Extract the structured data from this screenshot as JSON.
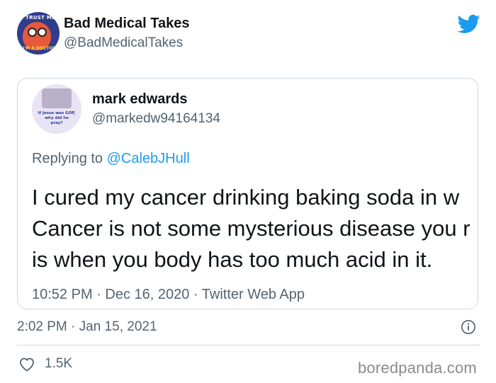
{
  "author": {
    "name": "Bad Medical Takes",
    "handle": "@BadMedicalTakes",
    "avatar_text_top": "TRUST ME,",
    "avatar_text_bottom": "I'M A DOCTOR"
  },
  "quoted_tweet": {
    "name": "mark edwards",
    "handle": "@markedw94164134",
    "avatar_lines": [
      "If Jesus was GOP,",
      "why did he",
      "pray?"
    ],
    "reply_prefix": "Replying to",
    "reply_to": "@CalebJHull",
    "body_lines": [
      "I cured my cancer drinking baking soda in w",
      "Cancer is not some mysterious disease you r",
      "is when you body has too much acid in it."
    ],
    "meta": "10:52 PM · Dec 16, 2020 · Twitter Web App"
  },
  "timestamp": "2:02 PM · Jan 15, 2021",
  "likes": "1.5K",
  "watermark": "boredpanda.com",
  "colors": {
    "twitter_blue": "#1d9bf0",
    "secondary_text": "#536471",
    "border": "#cfd9de"
  },
  "icons": {
    "brand": "twitter-bird-icon",
    "info": "info-icon",
    "like": "heart-icon"
  }
}
